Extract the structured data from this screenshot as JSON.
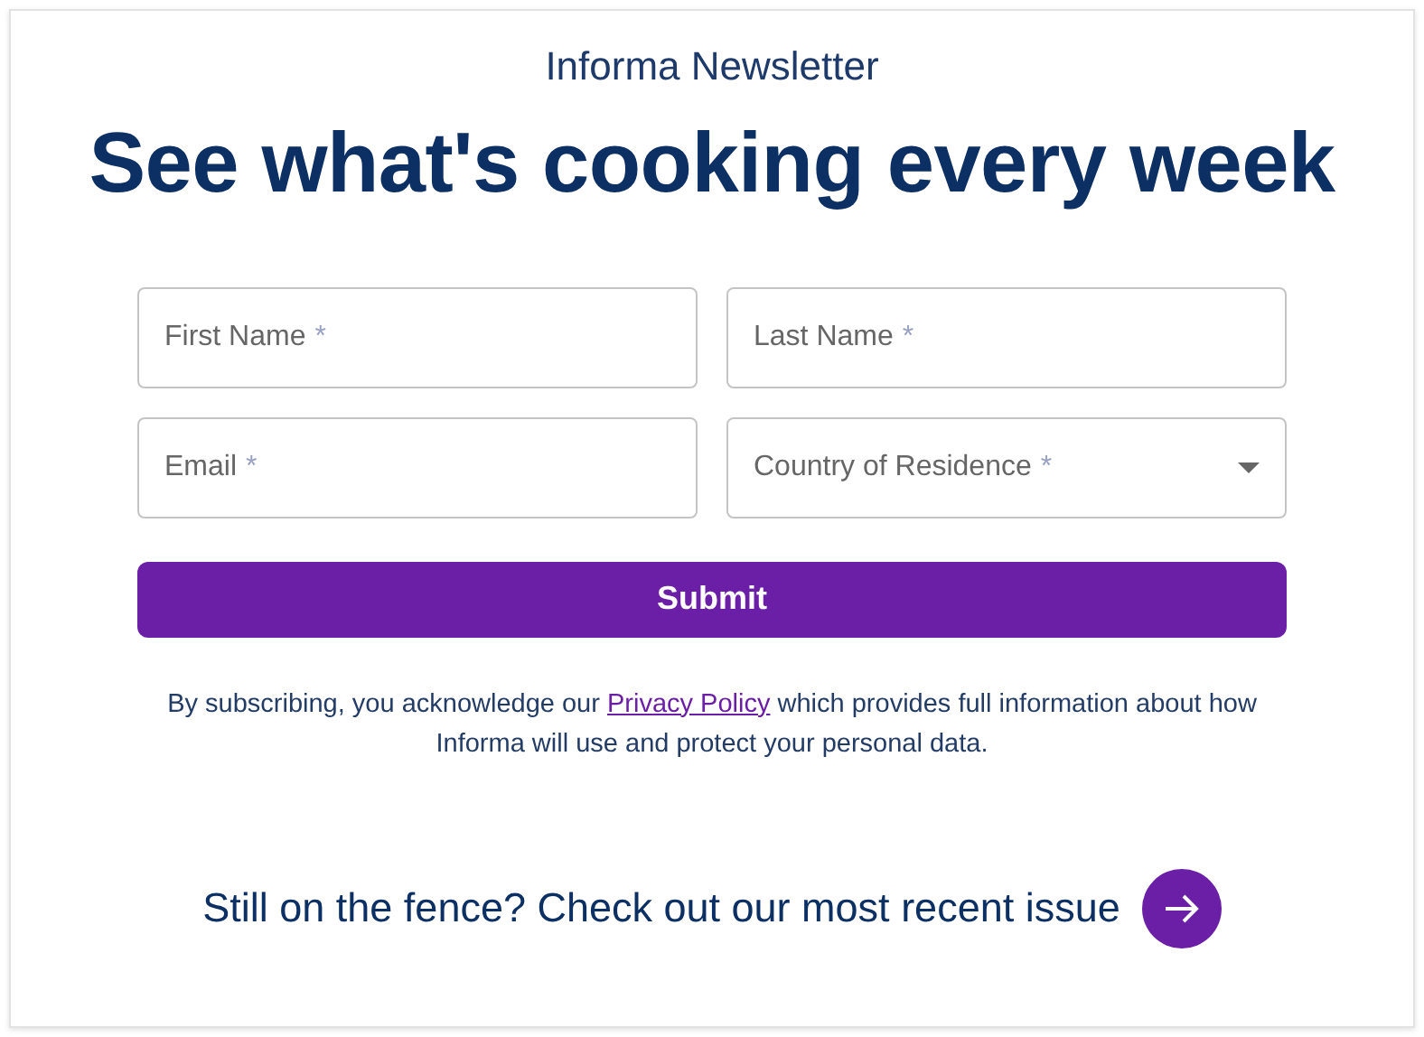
{
  "eyebrow": "Informa Newsletter",
  "headline": "See what's cooking every week",
  "fields": [
    {
      "kind": "text",
      "placeholder": "First Name",
      "required_mark": "*"
    },
    {
      "kind": "text",
      "placeholder": "Last Name",
      "required_mark": "*"
    },
    {
      "kind": "text",
      "placeholder": "Email",
      "required_mark": "*"
    },
    {
      "kind": "select",
      "placeholder": "Country of Residence",
      "required_mark": "*"
    }
  ],
  "submit": "Submit",
  "consent": {
    "before": "By subscribing, you acknowledge our",
    "link": "Privacy Policy",
    "after": "which provides full information about how Informa will use and protect your personal data."
  },
  "cta": {
    "label": "Still on the fence? Check out our most recent issue"
  }
}
